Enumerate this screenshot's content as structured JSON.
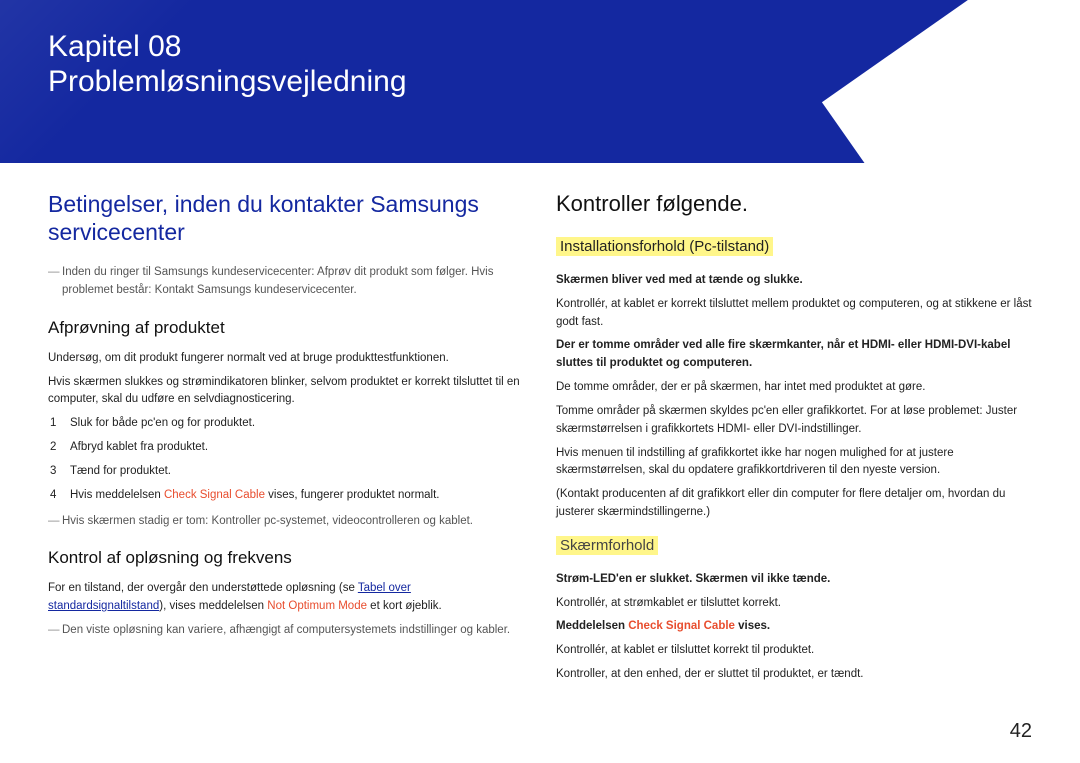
{
  "hero": {
    "chapter": "Kapitel 08",
    "title": "Problemløsningsvejledning"
  },
  "left": {
    "h_blue": "Betingelser, inden du kontakter Samsungs servicecenter",
    "note1": "Inden du ringer til Samsungs kundeservicecenter: Afprøv dit produkt som følger. Hvis problemet består: Kontakt Samsungs kundeservicecenter.",
    "h_sub1": "Afprøvning af produktet",
    "p1": "Undersøg, om dit produkt fungerer normalt ved at bruge produkttestfunktionen.",
    "p2": "Hvis skærmen slukkes og strømindikatoren blinker, selvom produktet er korrekt tilsluttet til en computer, skal du udføre en selvdiagnosticering.",
    "steps": [
      "Sluk for både pc'en og for produktet.",
      "Afbryd kablet fra produktet.",
      "Tænd for produktet."
    ],
    "step4_prefix": "Hvis meddelelsen ",
    "step4_red": "Check Signal Cable",
    "step4_suffix": " vises, fungerer produktet normalt.",
    "note2": "Hvis skærmen stadig er tom: Kontroller pc-systemet, videocontrolleren og kablet.",
    "h_sub2": "Kontrol af opløsning og frekvens",
    "p3_prefix": "For en tilstand, der overgår den understøttede opløsning (se ",
    "p3_link": "Tabel over standardsignaltilstand",
    "p3_mid": "), vises meddelelsen ",
    "p3_red": "Not Optimum Mode",
    "p3_suffix": " et kort øjeblik.",
    "note3": "Den viste opløsning kan variere, afhængigt af computersystemets indstillinger og kabler."
  },
  "right": {
    "h_black": "Kontroller følgende.",
    "hl1": "Installationsforhold (Pc-tilstand)",
    "g1_bold": "Skærmen bliver ved med at tænde og slukke.",
    "g1_p": "Kontrollér, at kablet er korrekt tilsluttet mellem produktet og computeren, og at stikkene er låst godt fast.",
    "g2_bold": "Der er tomme områder ved alle fire skærmkanter, når et HDMI- eller HDMI-DVI-kabel sluttes til produktet og computeren.",
    "g2_p1": "De tomme områder, der er på skærmen, har intet med produktet at gøre.",
    "g2_p2": "Tomme områder på skærmen skyldes pc'en eller grafikkortet. For at løse problemet: Juster skærmstørrelsen i grafikkortets HDMI- eller DVI-indstillinger.",
    "g2_p3": "Hvis menuen til indstilling af grafikkortet ikke har nogen mulighed for at justere skærmstørrelsen, skal du opdatere grafikkortdriveren til den nyeste version.",
    "g2_p4": "(Kontakt producenten af dit grafikkort eller din computer for flere detaljer om, hvordan du justerer skærmindstillingerne.)",
    "hl2": "Skærmforhold",
    "g3_bold": "Strøm-LED'en er slukket. Skærmen vil ikke tænde.",
    "g3_p": "Kontrollér, at strømkablet er tilsluttet korrekt.",
    "g4_bold_prefix": "Meddelelsen ",
    "g4_bold_red": "Check Signal Cable",
    "g4_bold_suffix": " vises.",
    "g4_p1": "Kontrollér, at kablet er tilsluttet korrekt til produktet.",
    "g4_p2": "Kontroller, at den enhed, der er sluttet til produktet, er tændt."
  },
  "pagenum": "42"
}
